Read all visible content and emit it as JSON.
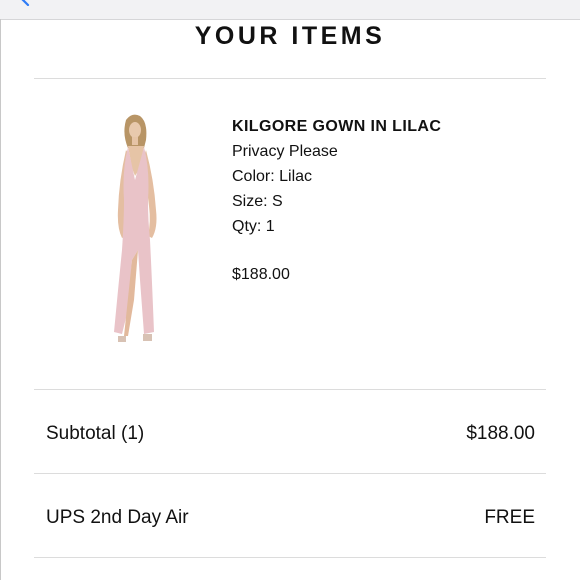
{
  "header": {
    "title": "YOUR ITEMS"
  },
  "item": {
    "name": "KILGORE GOWN IN LILAC",
    "brand": "Privacy Please",
    "color": "Color: Lilac",
    "size": "Size: S",
    "quantity": "Qty: 1",
    "price": "$188.00",
    "image_icon": "dress-photo"
  },
  "summary": {
    "subtotal_label": "Subtotal (1)",
    "subtotal_value": "$188.00",
    "shipping_label": "UPS 2nd Day Air",
    "shipping_value": "FREE"
  },
  "colors": {
    "accent": "#2f7cf6",
    "dress": "#e9c3c8",
    "divider": "#dcdcdc"
  }
}
